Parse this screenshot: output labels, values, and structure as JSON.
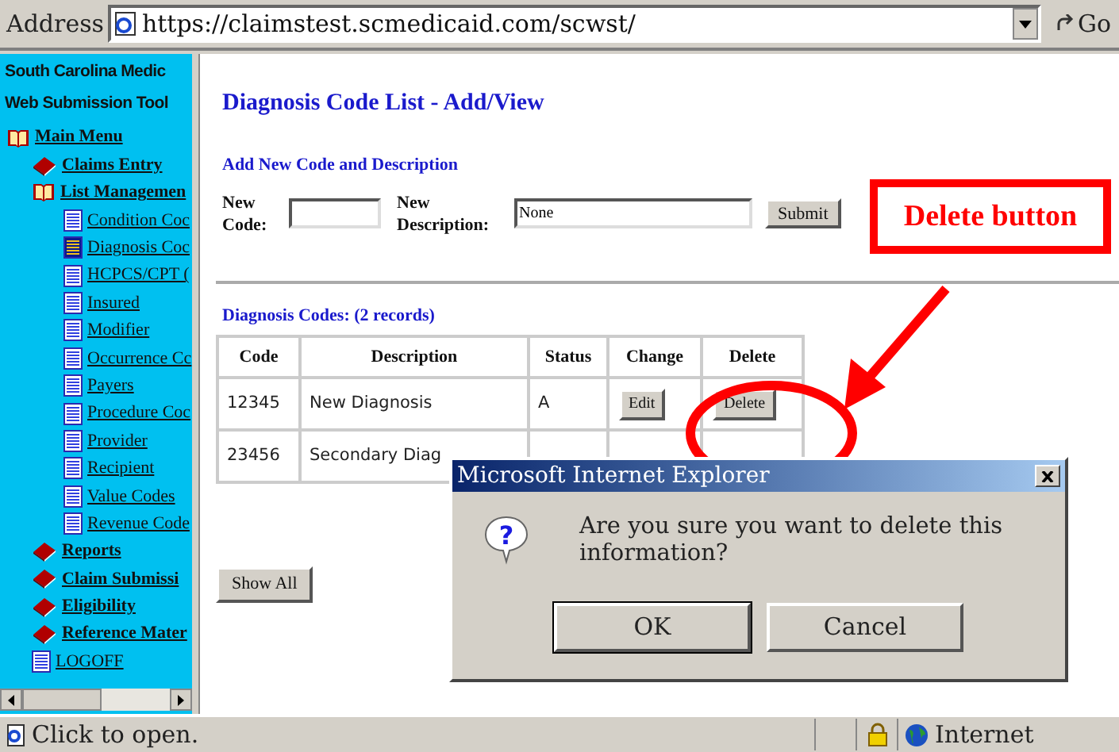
{
  "address_bar": {
    "label": "Address",
    "url": "https://claimstest.scmedicaid.com/scwst/",
    "go": "Go"
  },
  "sidebar": {
    "title_lines": [
      "South Carolina Medic",
      "Web Submission Tool"
    ],
    "items": [
      {
        "label": "Main Menu",
        "kind": "book",
        "expanded": true,
        "children": [
          {
            "label": "Claims Entry",
            "kind": "book",
            "expanded": false
          },
          {
            "label": "List Managemen",
            "kind": "book",
            "expanded": true,
            "children": [
              {
                "label": "Condition Coc",
                "kind": "page",
                "selected": false
              },
              {
                "label": "Diagnosis Coc",
                "kind": "page",
                "selected": true
              },
              {
                "label": "HCPCS/CPT (",
                "kind": "page",
                "selected": false
              },
              {
                "label": "Insured",
                "kind": "page",
                "selected": false
              },
              {
                "label": "Modifier",
                "kind": "page",
                "selected": false
              },
              {
                "label": "Occurrence Cc",
                "kind": "page",
                "selected": false
              },
              {
                "label": "Payers",
                "kind": "page",
                "selected": false
              },
              {
                "label": "Procedure Coc",
                "kind": "page",
                "selected": false
              },
              {
                "label": "Provider",
                "kind": "page",
                "selected": false
              },
              {
                "label": "Recipient",
                "kind": "page",
                "selected": false
              },
              {
                "label": "Value Codes",
                "kind": "page",
                "selected": false
              },
              {
                "label": "Revenue Code",
                "kind": "page",
                "selected": false
              }
            ]
          },
          {
            "label": "Reports",
            "kind": "book",
            "expanded": false
          },
          {
            "label": "Claim Submissi",
            "kind": "book",
            "expanded": false
          },
          {
            "label": "Eligibility",
            "kind": "book",
            "expanded": false
          },
          {
            "label": "Reference Mater",
            "kind": "book",
            "expanded": false
          },
          {
            "label": "LOGOFF",
            "kind": "page",
            "selected": false
          }
        ]
      }
    ]
  },
  "page": {
    "title": "Diagnosis Code List - Add/View",
    "add_section": {
      "heading": "Add New Code and Description",
      "code_label": "New Code:",
      "description_label": "New Description:",
      "description_value": "None",
      "submit": "Submit"
    },
    "list_heading": "Diagnosis Codes: (2 records)",
    "table": {
      "columns": [
        "Code",
        "Description",
        "Status",
        "Change",
        "Delete"
      ],
      "rows": [
        {
          "code": "12345",
          "description": "New Diagnosis",
          "status": "A",
          "edit": "Edit",
          "delete": "Delete"
        },
        {
          "code": "23456",
          "description": "Secondary Diag"
        }
      ]
    },
    "show_all": "Show All"
  },
  "annotation": {
    "label": "Delete button"
  },
  "dialog": {
    "title": "Microsoft Internet Explorer",
    "icon_glyph": "?",
    "message": "Are you sure you want to delete this information?",
    "buttons": [
      {
        "label": "OK",
        "selected": true
      },
      {
        "label": "Cancel",
        "selected": false
      }
    ]
  },
  "status_bar": {
    "text": "Click to open.",
    "zone": "Internet"
  }
}
